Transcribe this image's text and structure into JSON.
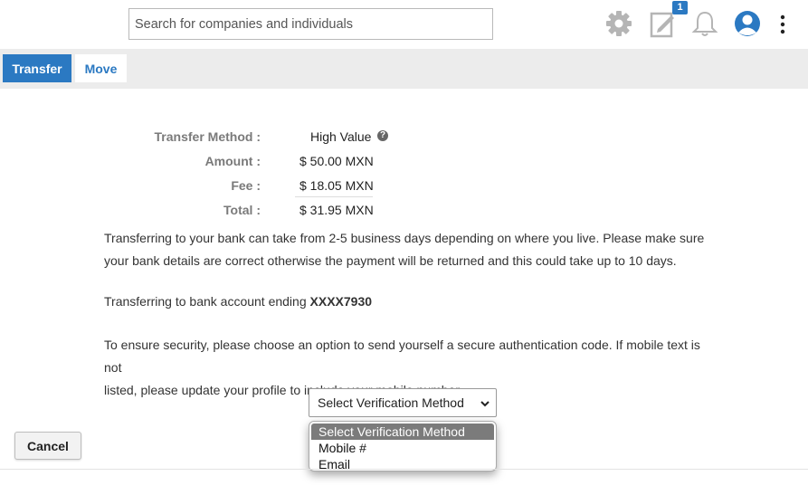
{
  "header": {
    "search_placeholder": "Search for companies and individuals",
    "notification_badge": "1",
    "icons": [
      "gear-icon",
      "edit-note-icon",
      "bell-icon",
      "user-avatar-icon",
      "more-vertical-icon"
    ]
  },
  "tabs": [
    {
      "label": "Transfer",
      "active": true
    },
    {
      "label": "Move",
      "active": false
    }
  ],
  "summary": {
    "method_label": "Transfer Method :",
    "method_value": "High Value",
    "amount_label": "Amount :",
    "amount_value": "$ 50.00 MXN",
    "fee_label": "Fee :",
    "fee_value": "$ 18.05 MXN",
    "total_label": "Total :",
    "total_value": "$ 31.95 MXN"
  },
  "info": {
    "bank_notice_line1": "Transferring to your bank can take from 2-5 business days depending on where you live. Please make sure",
    "bank_notice_line2": "your bank details are correct otherwise the payment will be returned and this could take up to 10 days.",
    "account_prefix": "Transferring to bank account ending ",
    "account_number": "XXXX7930",
    "security_line1": "To ensure security, please choose an option to send yourself a secure authentication code. If mobile text is not",
    "security_line2": "listed, please update your profile to include your mobile number."
  },
  "verification": {
    "selected": "Select Verification Method",
    "options": [
      "Select Verification Method",
      "Mobile #",
      "Email"
    ]
  },
  "actions": {
    "cancel_label": "Cancel"
  },
  "colors": {
    "accent": "#2b79c2",
    "tabstrip_bg": "#ececec",
    "label_gray": "#7a7a7a"
  }
}
